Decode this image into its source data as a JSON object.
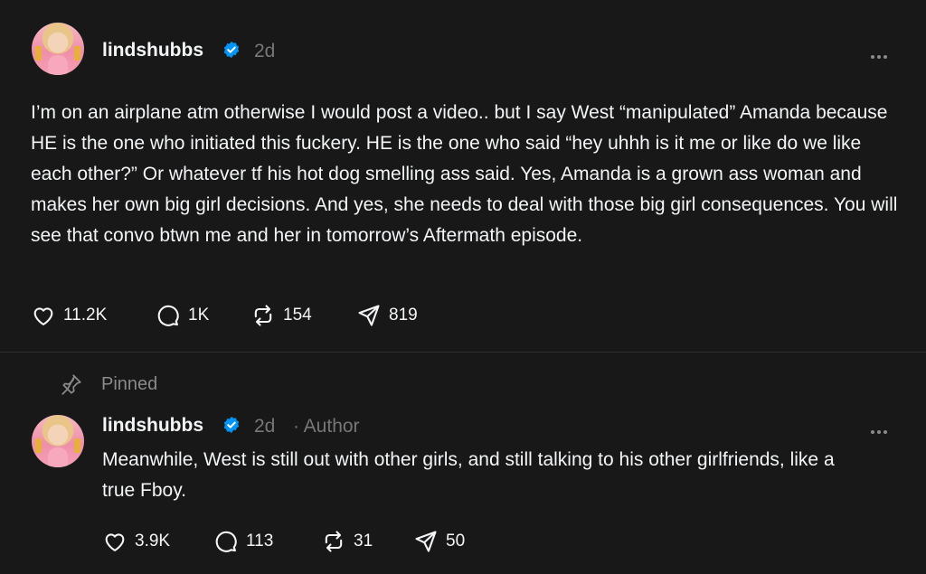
{
  "post1": {
    "username": "lindshubbs",
    "time": "2d",
    "text": "I’m on an airplane atm otherwise I would post a video.. but I say West “manipulated” Amanda because HE is the one who initiated this fuckery. HE is the one who said “hey uhhh is it me or like do we like each other?” Or whatever tf his hot dog smelling ass said. Yes, Amanda is a grown ass woman and makes her own big girl decisions. And yes, she needs to deal with those big girl consequences. You will see that convo btwn me and her in tomorrow’s Aftermath episode.",
    "likes": "11.2K",
    "replies": "1K",
    "reposts": "154",
    "shares": "819"
  },
  "pinned_label": "Pinned",
  "post2": {
    "username": "lindshubbs",
    "time": "2d",
    "author_tag": "· Author",
    "text": "Meanwhile, West is still out with other girls, and still talking to his other girlfriends, like a true Fboy.",
    "likes": "3.9K",
    "replies": "113",
    "reposts": "31",
    "shares": "50"
  },
  "colors": {
    "background": "#181818",
    "text": "#f3f5f7",
    "muted": "#777777",
    "verified": "#0095f6"
  }
}
